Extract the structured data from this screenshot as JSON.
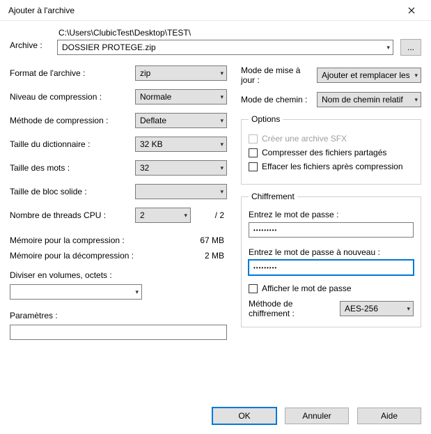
{
  "window": {
    "title": "Ajouter à l'archive"
  },
  "archive": {
    "label": "Archive :",
    "path": "C:\\Users\\ClubicTest\\Desktop\\TEST\\",
    "filename": "DOSSIER PROTEGE.zip",
    "browse": "..."
  },
  "left": {
    "format_label": "Format de l'archive :",
    "format_value": "zip",
    "level_label": "Niveau de compression :",
    "level_value": "Normale",
    "method_label": "Méthode de compression :",
    "method_value": "Deflate",
    "dict_label": "Taille du dictionnaire :",
    "dict_value": "32 KB",
    "word_label": "Taille des mots :",
    "word_value": "32",
    "block_label": "Taille de bloc solide :",
    "block_value": "",
    "threads_label": "Nombre de threads CPU :",
    "threads_value": "2",
    "threads_total": "/ 2",
    "mem_comp_label": "Mémoire pour la compression :",
    "mem_comp_value": "67 MB",
    "mem_decomp_label": "Mémoire pour la décompression :",
    "mem_decomp_value": "2 MB",
    "split_label": "Diviser en volumes, octets :",
    "params_label": "Paramètres :"
  },
  "right": {
    "update_label": "Mode de mise à jour :",
    "update_value": "Ajouter et remplacer les fich",
    "path_label": "Mode de chemin :",
    "path_value": "Nom de chemin relatif",
    "options_legend": "Options",
    "opt_sfx": "Créer une archive SFX",
    "opt_shared": "Compresser des fichiers partagés",
    "opt_delete": "Effacer les fichiers après compression",
    "enc_legend": "Chiffrement",
    "pw1_label": "Entrez le mot de passe :",
    "pw1_value": "•••••••••",
    "pw2_label": "Entrez le mot de passe à nouveau :",
    "pw2_value": "•••••••••",
    "show_pw": "Afficher le mot de passe",
    "enc_method_label": "Méthode de chiffrement :",
    "enc_method_value": "AES-256"
  },
  "buttons": {
    "ok": "OK",
    "cancel": "Annuler",
    "help": "Aide"
  }
}
